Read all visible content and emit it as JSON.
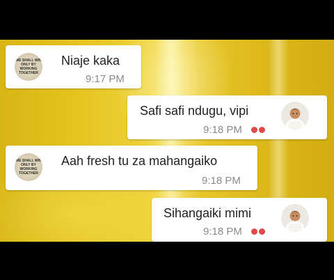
{
  "messages": [
    {
      "direction": "incoming",
      "text": "Niaje kaka",
      "time": "9:17 PM"
    },
    {
      "direction": "outgoing",
      "text": "Safi safi ndugu, vipi",
      "time": "9:18 PM",
      "read_icon": "double-red-dots-icon"
    },
    {
      "direction": "incoming",
      "text": "Aah fresh tu za mahangaiko",
      "time": "9:18 PM"
    },
    {
      "direction": "outgoing",
      "text": "Sihangaiki mimi",
      "time": "9:18 PM",
      "read_icon": "double-red-dots-icon"
    }
  ],
  "contact_avatar": {
    "lines": [
      "WE SHALL WIN",
      "ONLY BY",
      "WORKING",
      "TOGETHER"
    ]
  },
  "colors": {
    "wallpaper": "#e4c21c",
    "bubble": "#ffffff",
    "read_indicator": "#e24a4a",
    "time_text": "#8a8a8a",
    "letterbox": "#000000"
  }
}
